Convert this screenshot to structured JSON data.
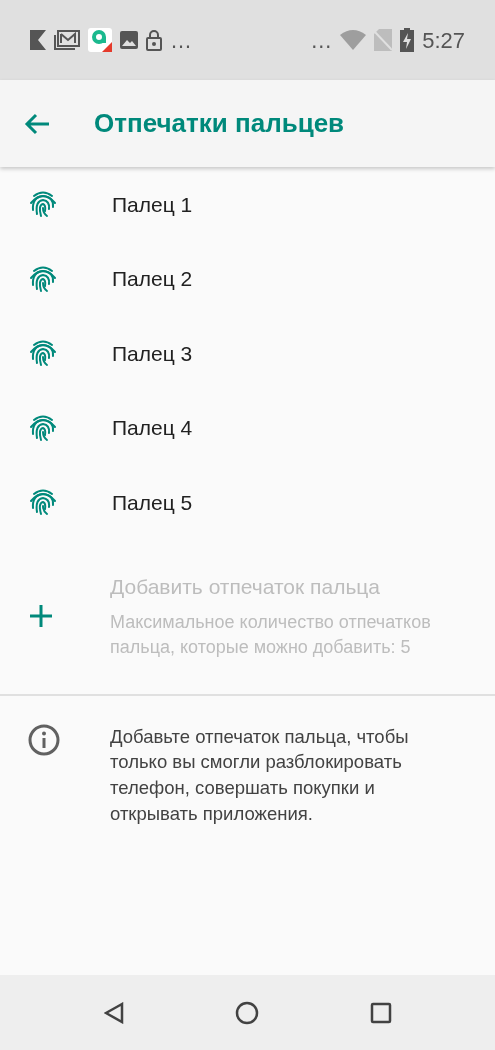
{
  "status_bar": {
    "left_overflow": "…",
    "right_overflow": "…",
    "time": "5:27"
  },
  "app_bar": {
    "title": "Отпечатки пальцев"
  },
  "fingerprints": [
    {
      "label": "Палец 1"
    },
    {
      "label": "Палец 2"
    },
    {
      "label": "Палец 3"
    },
    {
      "label": "Палец 4"
    },
    {
      "label": "Палец 5"
    }
  ],
  "add_item": {
    "title": "Добавить отпечаток пальца",
    "summary": "Максимальное количество отпечатков пальца, которые можно добавить: 5",
    "disabled": true
  },
  "info": {
    "text": "Добавьте отпечаток пальца, чтобы только вы смогли разблокировать телефон, совершать покупки и открывать приложения."
  }
}
